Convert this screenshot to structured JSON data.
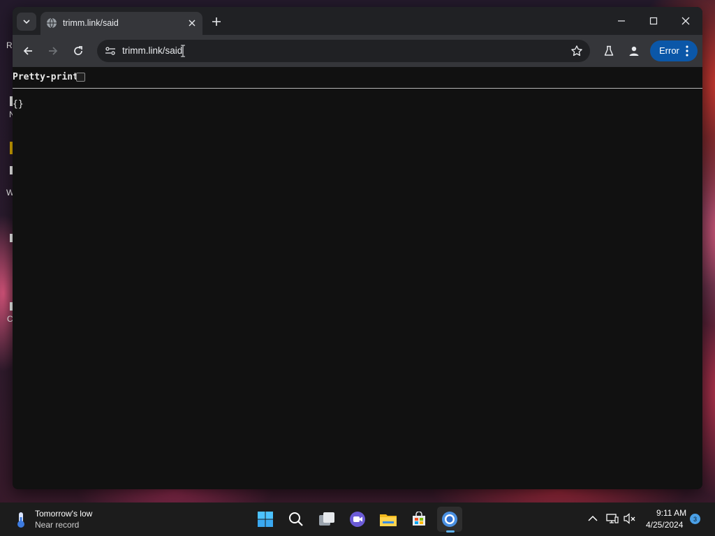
{
  "browser": {
    "tab": {
      "title": "trimm.link/said"
    },
    "address_bar": {
      "url": "trimm.link/said"
    },
    "profile_button": {
      "label": "Error"
    }
  },
  "page": {
    "pretty_print_label": "Pretty-print",
    "pretty_print_checked": false,
    "json_text": "{}"
  },
  "taskbar": {
    "weather": {
      "title": "Tomorrow's low",
      "subtitle": "Near record"
    },
    "clock": {
      "time": "9:11 AM",
      "date": "4/25/2024"
    },
    "notification_count": "3"
  },
  "desktop_fragments": {
    "frag_1": "R",
    "frag_2": "N",
    "frag_3": "W",
    "frag_4": "C"
  },
  "colors": {
    "accent_error_pill": "#0b57a8",
    "active_app_indicator": "#5fb2f2"
  },
  "icons": [
    "tab-search-icon",
    "globe-icon",
    "close-icon",
    "plus-icon",
    "minimize-icon",
    "maximize-icon",
    "back-icon",
    "forward-icon",
    "reload-icon",
    "site-info-icon",
    "star-icon",
    "labs-icon",
    "profile-icon",
    "more-vert-icon",
    "thermometer-icon",
    "windows-start-icon",
    "search-icon",
    "task-view-icon",
    "teams-icon",
    "file-explorer-icon",
    "store-icon",
    "chrome-icon",
    "chevron-up-icon",
    "network-icon",
    "volume-muted-icon"
  ]
}
